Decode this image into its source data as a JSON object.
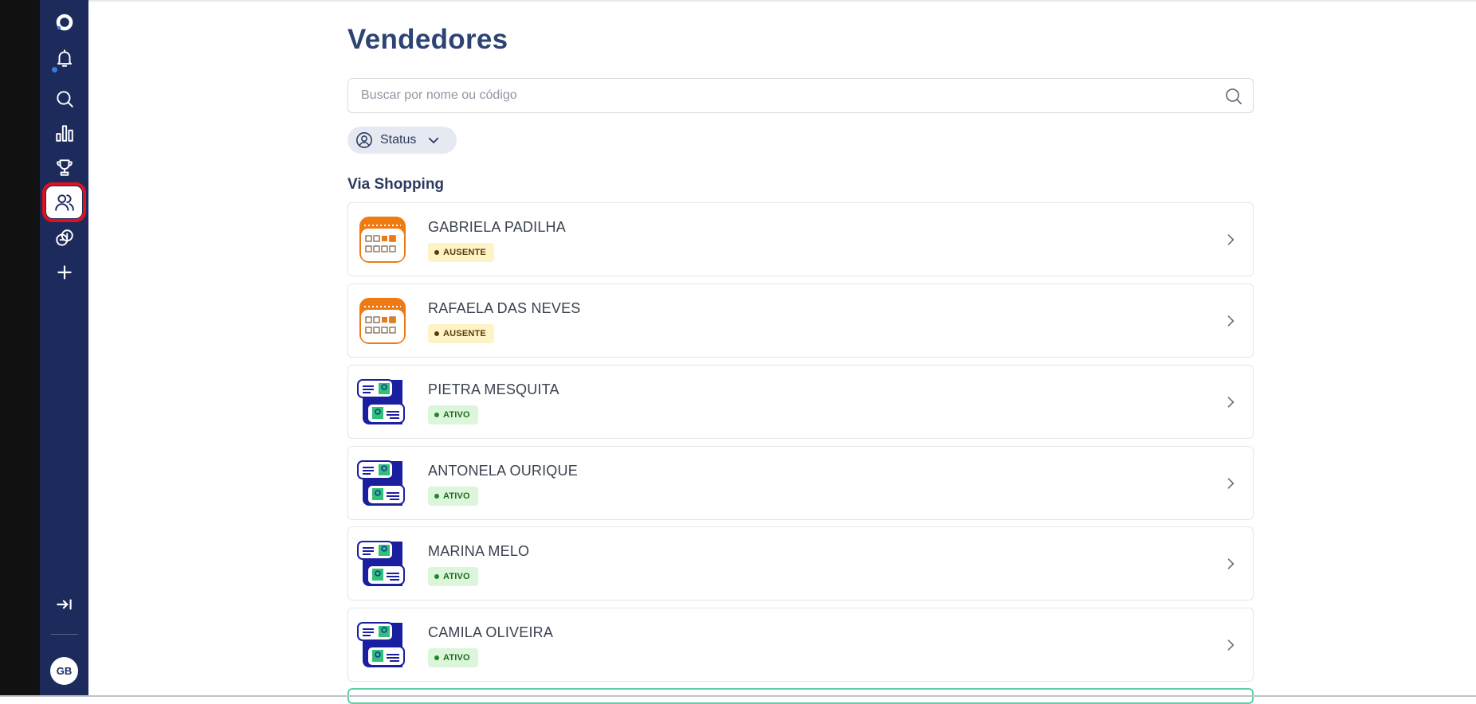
{
  "page": {
    "title": "Vendedores",
    "search_placeholder": "Buscar por nome ou código",
    "search_value": "",
    "status_filter_label": "Status",
    "group_title": "Via Shopping"
  },
  "sidebar": {
    "items": [
      {
        "icon": "logo-icon"
      },
      {
        "icon": "bell-icon",
        "has_notification": true
      },
      {
        "icon": "search-icon"
      },
      {
        "icon": "bar-chart-icon"
      },
      {
        "icon": "trophy-icon"
      },
      {
        "icon": "users-icon",
        "active": true
      },
      {
        "icon": "coins-icon"
      },
      {
        "icon": "plus-icon"
      },
      {
        "icon": "expand-icon"
      }
    ],
    "avatar_initials": "GB"
  },
  "sellers": [
    {
      "name": "GABRIELA PADILHA",
      "status": "AUSENTE",
      "thumb": "calendar-icon"
    },
    {
      "name": "RAFAELA DAS NEVES",
      "status": "AUSENTE",
      "thumb": "calendar-icon"
    },
    {
      "name": "PIETRA MESQUITA",
      "status": "ATIVO",
      "thumb": "id-cards-icon"
    },
    {
      "name": "ANTONELA OURIQUE",
      "status": "ATIVO",
      "thumb": "id-cards-icon"
    },
    {
      "name": "MARINA MELO",
      "status": "ATIVO",
      "thumb": "id-cards-icon"
    },
    {
      "name": "CAMILA OLIVEIRA",
      "status": "ATIVO",
      "thumb": "id-cards-icon"
    }
  ],
  "colors": {
    "sidebar_bg": "#1d2b5c",
    "title": "#2d4373",
    "active_highlight": "#e0101c",
    "ausente_bg": "#fdf3c6",
    "ativo_bg": "#dcf6dc"
  }
}
